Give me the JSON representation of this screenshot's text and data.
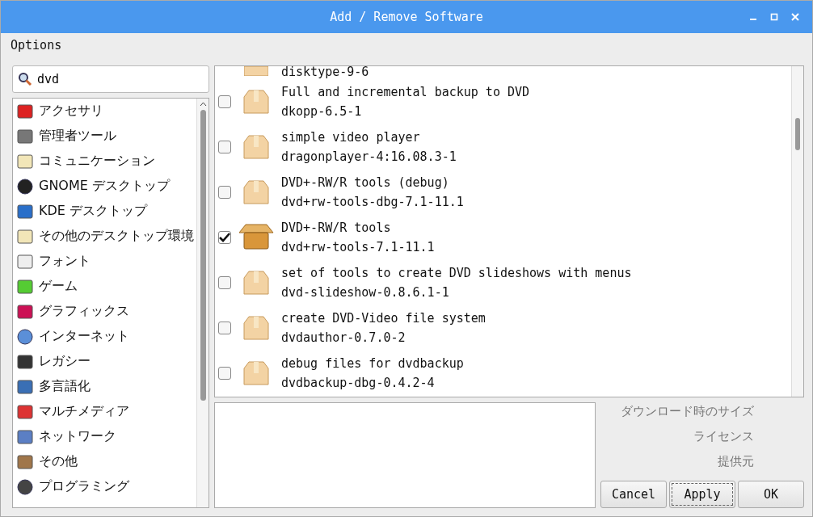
{
  "window": {
    "title": "Add / Remove Software"
  },
  "menu": [
    "Options"
  ],
  "search": {
    "value": "dvd"
  },
  "categories": [
    {
      "label": "アクセサリ"
    },
    {
      "label": "管理者ツール"
    },
    {
      "label": "コミュニケーション"
    },
    {
      "label": "GNOME デスクトップ"
    },
    {
      "label": "KDE デスクトップ"
    },
    {
      "label": "その他のデスクトップ環境"
    },
    {
      "label": "フォント"
    },
    {
      "label": "ゲーム"
    },
    {
      "label": "グラフィックス"
    },
    {
      "label": "インターネット"
    },
    {
      "label": "レガシー"
    },
    {
      "label": "多言語化"
    },
    {
      "label": "マルチメディア"
    },
    {
      "label": "ネットワーク"
    },
    {
      "label": "その他"
    },
    {
      "label": "プログラミング"
    }
  ],
  "packages": [
    {
      "name": "disktype-9-6"
    },
    {
      "summary": "Full and incremental backup to DVD",
      "name": "dkopp-6.5-1",
      "checked": false
    },
    {
      "summary": "simple video player",
      "name": "dragonplayer-4:16.08.3-1",
      "checked": false
    },
    {
      "summary": "DVD+-RW/R tools (debug)",
      "name": "dvd+rw-tools-dbg-7.1-11.1",
      "checked": false
    },
    {
      "summary": "DVD+-RW/R tools",
      "name": "dvd+rw-tools-7.1-11.1",
      "checked": true
    },
    {
      "summary": "set of tools to create DVD slideshows with menus",
      "name": "dvd-slideshow-0.8.6.1-1",
      "checked": false
    },
    {
      "summary": "create DVD-Video file system",
      "name": "dvdauthor-0.7.0-2",
      "checked": false
    },
    {
      "summary": "debug files for dvdbackup",
      "name": "dvdbackup-dbg-0.4.2-4",
      "checked": false
    }
  ],
  "details": [
    "ダウンロード時のサイズ",
    "ライセンス",
    "提供元"
  ],
  "buttons": [
    {
      "label": "Cancel",
      "focused": false
    },
    {
      "label": "Apply",
      "focused": true
    },
    {
      "label": "OK",
      "focused": false
    }
  ]
}
